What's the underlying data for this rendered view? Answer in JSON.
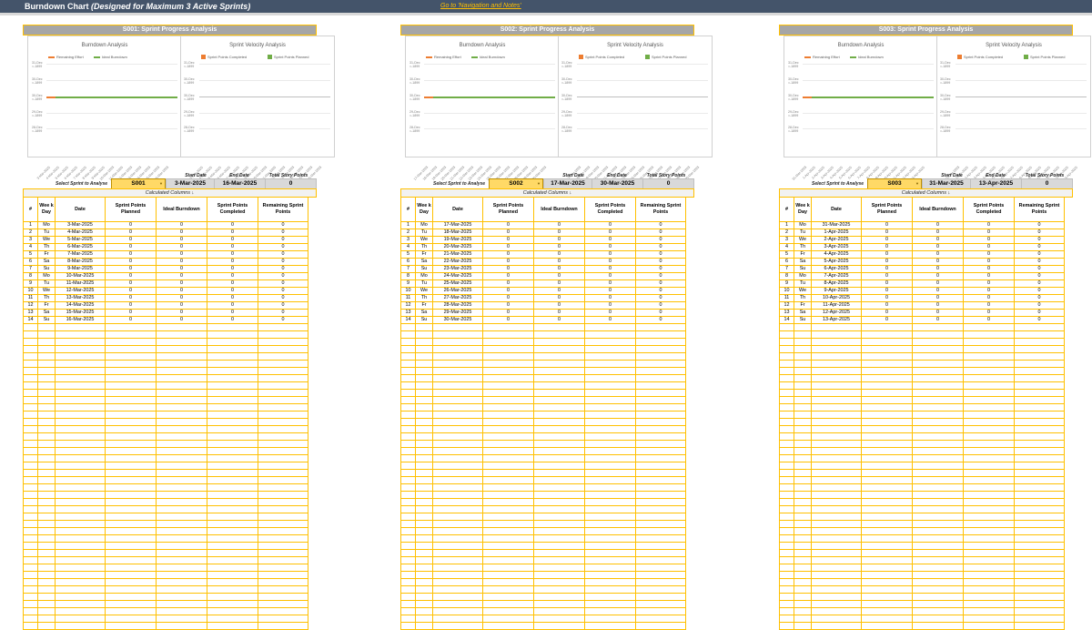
{
  "header": {
    "title": "Burndown Chart",
    "subtitle": "(Designed for Maximum 3 Active Sprints)",
    "nav_link": "Go to 'Navigation and Notes'"
  },
  "labels": {
    "select_sprint": "Select Sprint to Analyse",
    "start_date": "Start Date",
    "end_date": "End Date",
    "total_story_points": "Total Story Points",
    "calculated_columns": "Calculated Columns ↓",
    "burndown_title": "Burndown Analysis",
    "velocity_title": "Sprint Velocity Analysis",
    "legend_remaining": "Remaining Effort",
    "legend_ideal": "Ideal Burndown",
    "legend_completed": "Sprint Points Completed",
    "legend_planned": "Sprint Points Planned"
  },
  "columns": [
    "#",
    "Wee k Day",
    "Date",
    "Sprint Points Planned",
    "Ideal Burndown",
    "Sprint Points Completed",
    "Remaining Sprint Points"
  ],
  "burndown_yticks": [
    "31-Dec =-1899",
    "30-Dec =-1899",
    "30-Dec =-1899",
    "29-Dec =-1899",
    "28-Dec =-1899"
  ],
  "velocity_yticks": [
    "31-Dec =-1899",
    "30-Dec =-1899",
    "30-Dec =-1899",
    "29-Dec =-1899",
    "28-Dec =-1899"
  ],
  "colors": {
    "remaining": "#ed7d31",
    "ideal": "#70ad47",
    "completed": "#ed7d31",
    "planned": "#70ad47",
    "accent": "#ffc000",
    "titlebar": "#44546a"
  },
  "sprints": [
    {
      "heading": "S001: Sprint Progress Analysis",
      "sprint_id": "S001",
      "start": "3-Mar-2025",
      "end": "16-Mar-2025",
      "total": "0",
      "rows": [
        [
          "1",
          "Mo",
          "3-Mar-2025",
          "0",
          "0",
          "0",
          "0"
        ],
        [
          "2",
          "Tu",
          "4-Mar-2025",
          "0",
          "0",
          "0",
          "0"
        ],
        [
          "3",
          "We",
          "5-Mar-2025",
          "0",
          "0",
          "0",
          "0"
        ],
        [
          "4",
          "Th",
          "6-Mar-2025",
          "0",
          "0",
          "0",
          "0"
        ],
        [
          "5",
          "Fr",
          "7-Mar-2025",
          "0",
          "0",
          "0",
          "0"
        ],
        [
          "6",
          "Sa",
          "8-Mar-2025",
          "0",
          "0",
          "0",
          "0"
        ],
        [
          "7",
          "Su",
          "9-Mar-2025",
          "0",
          "0",
          "0",
          "0"
        ],
        [
          "8",
          "Mo",
          "10-Mar-2025",
          "0",
          "0",
          "0",
          "0"
        ],
        [
          "9",
          "Tu",
          "11-Mar-2025",
          "0",
          "0",
          "0",
          "0"
        ],
        [
          "10",
          "We",
          "12-Mar-2025",
          "0",
          "0",
          "0",
          "0"
        ],
        [
          "11",
          "Th",
          "13-Mar-2025",
          "0",
          "0",
          "0",
          "0"
        ],
        [
          "12",
          "Fr",
          "14-Mar-2025",
          "0",
          "0",
          "0",
          "0"
        ],
        [
          "13",
          "Sa",
          "15-Mar-2025",
          "0",
          "0",
          "0",
          "0"
        ],
        [
          "14",
          "Su",
          "16-Mar-2025",
          "0",
          "0",
          "0",
          "0"
        ]
      ],
      "xticks": [
        "3-Mar-2025",
        "4-Mar-2025",
        "5-Mar-2025",
        "6-Mar-2025",
        "7-Mar-2025",
        "8-Mar-2025",
        "9-Mar-2025",
        "10-Mar-2025",
        "11-Mar-2025",
        "12-Mar-2025",
        "13-Mar-2025",
        "14-Mar-2025",
        "15-Mar-2025",
        "16-Mar-2025"
      ]
    },
    {
      "heading": "S002: Sprint Progress Analysis",
      "sprint_id": "S002",
      "start": "17-Mar-2025",
      "end": "30-Mar-2025",
      "total": "0",
      "rows": [
        [
          "1",
          "Mo",
          "17-Mar-2025",
          "0",
          "0",
          "0",
          "0"
        ],
        [
          "2",
          "Tu",
          "18-Mar-2025",
          "0",
          "0",
          "0",
          "0"
        ],
        [
          "3",
          "We",
          "19-Mar-2025",
          "0",
          "0",
          "0",
          "0"
        ],
        [
          "4",
          "Th",
          "20-Mar-2025",
          "0",
          "0",
          "0",
          "0"
        ],
        [
          "5",
          "Fr",
          "21-Mar-2025",
          "0",
          "0",
          "0",
          "0"
        ],
        [
          "6",
          "Sa",
          "22-Mar-2025",
          "0",
          "0",
          "0",
          "0"
        ],
        [
          "7",
          "Su",
          "23-Mar-2025",
          "0",
          "0",
          "0",
          "0"
        ],
        [
          "8",
          "Mo",
          "24-Mar-2025",
          "0",
          "0",
          "0",
          "0"
        ],
        [
          "9",
          "Tu",
          "25-Mar-2025",
          "0",
          "0",
          "0",
          "0"
        ],
        [
          "10",
          "We",
          "26-Mar-2025",
          "0",
          "0",
          "0",
          "0"
        ],
        [
          "11",
          "Th",
          "27-Mar-2025",
          "0",
          "0",
          "0",
          "0"
        ],
        [
          "12",
          "Fr",
          "28-Mar-2025",
          "0",
          "0",
          "0",
          "0"
        ],
        [
          "13",
          "Sa",
          "29-Mar-2025",
          "0",
          "0",
          "0",
          "0"
        ],
        [
          "14",
          "Su",
          "30-Mar-2025",
          "0",
          "0",
          "0",
          "0"
        ]
      ],
      "xticks": [
        "17-Mar-2025",
        "18-Mar-2025",
        "19-Mar-2025",
        "20-Mar-2025",
        "21-Mar-2025",
        "22-Mar-2025",
        "23-Mar-2025",
        "24-Mar-2025",
        "25-Mar-2025",
        "26-Mar-2025",
        "27-Mar-2025",
        "28-Mar-2025",
        "29-Mar-2025",
        "30-Mar-2025"
      ]
    },
    {
      "heading": "S003: Sprint Progress Analysis",
      "sprint_id": "S003",
      "start": "31-Mar-2025",
      "end": "13-Apr-2025",
      "total": "0",
      "rows": [
        [
          "1",
          "Mo",
          "31-Mar-2025",
          "0",
          "0",
          "0",
          "0"
        ],
        [
          "2",
          "Tu",
          "1-Apr-2025",
          "0",
          "0",
          "0",
          "0"
        ],
        [
          "3",
          "We",
          "2-Apr-2025",
          "0",
          "0",
          "0",
          "0"
        ],
        [
          "4",
          "Th",
          "3-Apr-2025",
          "0",
          "0",
          "0",
          "0"
        ],
        [
          "5",
          "Fr",
          "4-Apr-2025",
          "0",
          "0",
          "0",
          "0"
        ],
        [
          "6",
          "Sa",
          "5-Apr-2025",
          "0",
          "0",
          "0",
          "0"
        ],
        [
          "7",
          "Su",
          "6-Apr-2025",
          "0",
          "0",
          "0",
          "0"
        ],
        [
          "8",
          "Mo",
          "7-Apr-2025",
          "0",
          "0",
          "0",
          "0"
        ],
        [
          "9",
          "Tu",
          "8-Apr-2025",
          "0",
          "0",
          "0",
          "0"
        ],
        [
          "10",
          "We",
          "9-Apr-2025",
          "0",
          "0",
          "0",
          "0"
        ],
        [
          "11",
          "Th",
          "10-Apr-2025",
          "0",
          "0",
          "0",
          "0"
        ],
        [
          "12",
          "Fr",
          "11-Apr-2025",
          "0",
          "0",
          "0",
          "0"
        ],
        [
          "13",
          "Sa",
          "12-Apr-2025",
          "0",
          "0",
          "0",
          "0"
        ],
        [
          "14",
          "Su",
          "13-Apr-2025",
          "0",
          "0",
          "0",
          "0"
        ]
      ],
      "xticks": [
        "31-Mar-2025",
        "1-Apr-2025",
        "2-Apr-2025",
        "3-Apr-2025",
        "4-Apr-2025",
        "5-Apr-2025",
        "6-Apr-2025",
        "7-Apr-2025",
        "8-Apr-2025",
        "9-Apr-2025",
        "10-Apr-2025",
        "11-Apr-2025",
        "12-Apr-2025",
        "13-Apr-2025"
      ]
    }
  ]
}
